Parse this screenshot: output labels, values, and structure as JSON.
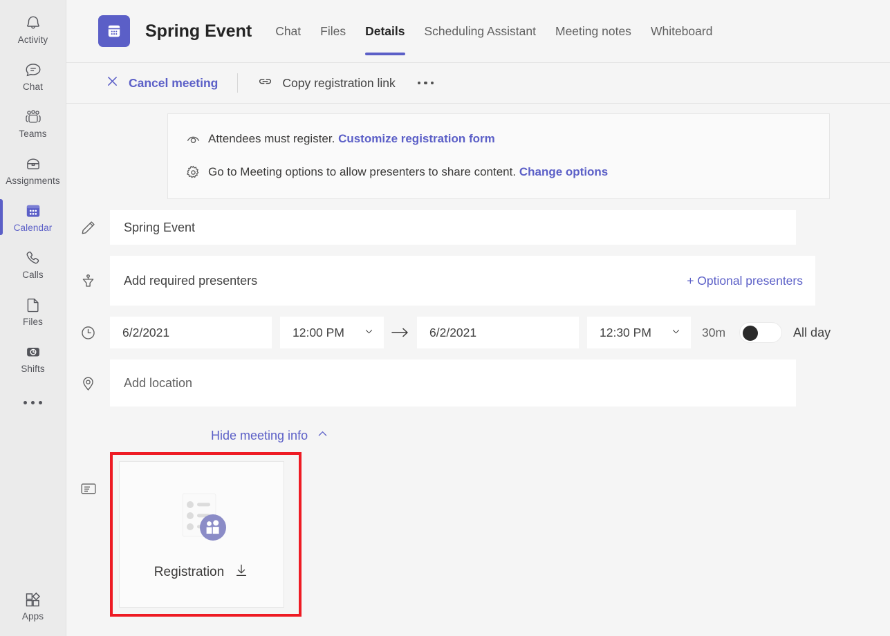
{
  "rail": {
    "items": [
      {
        "label": "Activity",
        "icon": "bell-icon",
        "active": false
      },
      {
        "label": "Chat",
        "icon": "chat-icon",
        "active": false
      },
      {
        "label": "Teams",
        "icon": "teams-icon",
        "active": false
      },
      {
        "label": "Assignments",
        "icon": "assignments-icon",
        "active": false
      },
      {
        "label": "Calendar",
        "icon": "calendar-icon",
        "active": true
      },
      {
        "label": "Calls",
        "icon": "phone-icon",
        "active": false
      },
      {
        "label": "Files",
        "icon": "file-icon",
        "active": false
      },
      {
        "label": "Shifts",
        "icon": "shifts-icon",
        "active": false
      }
    ],
    "more_label": "more-options-icon",
    "apps": {
      "label": "Apps",
      "icon": "apps-icon"
    }
  },
  "header": {
    "app_icon": "calendar-event-icon",
    "title": "Spring Event",
    "tabs": [
      {
        "label": "Chat",
        "active": false
      },
      {
        "label": "Files",
        "active": false
      },
      {
        "label": "Details",
        "active": true
      },
      {
        "label": "Scheduling Assistant",
        "active": false
      },
      {
        "label": "Meeting notes",
        "active": false
      },
      {
        "label": "Whiteboard",
        "active": false
      }
    ]
  },
  "toolbar": {
    "cancel_label": "Cancel meeting",
    "cancel_icon": "close-icon",
    "copy_label": "Copy registration link",
    "copy_icon": "link-icon",
    "more_label": "more-options-icon"
  },
  "banner": {
    "rows": [
      {
        "icon": "registration-eye-icon",
        "text": "Attendees must register.",
        "link": "Customize registration form"
      },
      {
        "icon": "gear-icon",
        "text": "Go to Meeting options to allow presenters to share content.",
        "link": "Change options"
      }
    ]
  },
  "form": {
    "title": {
      "icon": "pencil-icon",
      "value": "Spring Event"
    },
    "presenters": {
      "icon": "presenter-icon",
      "placeholder": "Add required presenters",
      "optional_label": "+ Optional presenters"
    },
    "datetime": {
      "icon": "clock-icon",
      "start_date": "6/2/2021",
      "start_time": "12:00 PM",
      "arrow": "→",
      "end_date": "6/2/2021",
      "end_time": "12:30 PM",
      "duration": "30m",
      "allday_label": "All day",
      "allday_on": false,
      "chevron": "chevron-down-icon"
    },
    "location": {
      "icon": "location-pin-icon",
      "placeholder": "Add location"
    },
    "hide_meeting_info": {
      "label": "Hide meeting info",
      "chevron": "chevron-up-icon"
    }
  },
  "registration": {
    "row_icon": "description-icon",
    "card_label": "Registration",
    "download_icon": "download-icon",
    "thumb_icon": "registration-form-people-icon",
    "highlight_color": "#ee1b24"
  },
  "colors": {
    "accent": "#5b5fc7",
    "rail_bg": "#ebebeb",
    "content_bg": "#f5f5f5",
    "field_bg": "#ffffff"
  }
}
